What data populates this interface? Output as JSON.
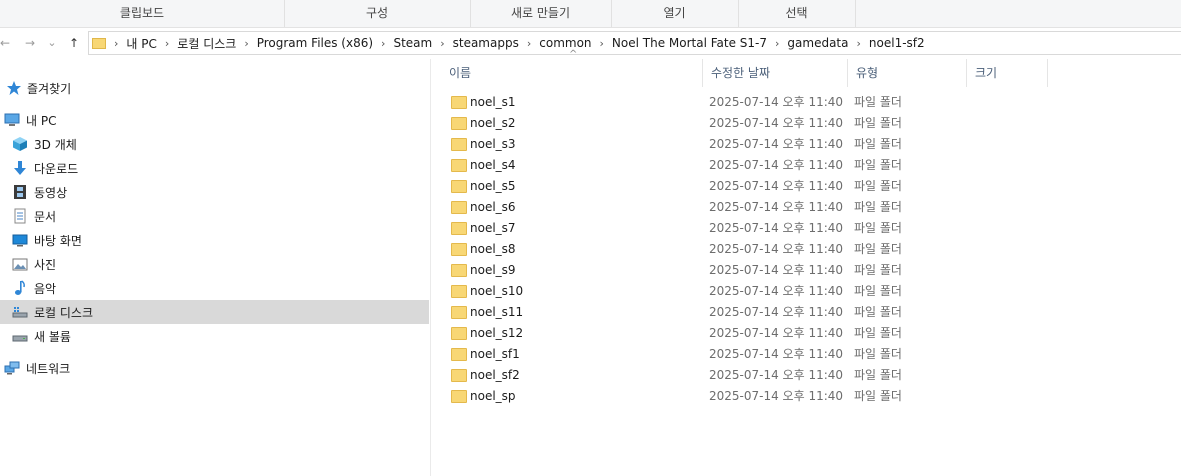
{
  "ribbon": {
    "groups": [
      "클립보드",
      "구성",
      "새로 만들기",
      "열기",
      "선택"
    ]
  },
  "nav_buttons": {
    "back": "←",
    "forward": "→",
    "recent": "⌄",
    "up": "↑"
  },
  "address": {
    "crumbs": [
      "내 PC",
      "로컬 디스크",
      "Program Files (x86)",
      "Steam",
      "steamapps",
      "common",
      "Noel The Mortal Fate S1-7",
      "gamedata",
      "noel1-sf2"
    ],
    "separator": "›"
  },
  "sidebar": {
    "items": [
      {
        "label": "즐겨찾기",
        "icon": "star-icon"
      },
      {
        "label": "내 PC",
        "icon": "pc-icon"
      },
      {
        "label": "3D 개체",
        "icon": "cube-icon"
      },
      {
        "label": "다운로드",
        "icon": "download-icon"
      },
      {
        "label": "동영상",
        "icon": "film-icon"
      },
      {
        "label": "문서",
        "icon": "document-icon"
      },
      {
        "label": "바탕 화면",
        "icon": "desktop-icon"
      },
      {
        "label": "사진",
        "icon": "picture-icon"
      },
      {
        "label": "음악",
        "icon": "music-icon"
      },
      {
        "label": "로컬 디스크",
        "icon": "drive-icon"
      },
      {
        "label": "새 볼륨",
        "icon": "drive-icon"
      },
      {
        "label": "네트워크",
        "icon": "network-icon"
      }
    ]
  },
  "columns": {
    "name": "이름",
    "date": "수정한 날짜",
    "type": "유형",
    "size": "크기",
    "sort_indicator": "^"
  },
  "files": [
    {
      "name": "noel_s1",
      "date": "2025-07-14 오후 11:40",
      "type": "파일 폴더"
    },
    {
      "name": "noel_s2",
      "date": "2025-07-14 오후 11:40",
      "type": "파일 폴더"
    },
    {
      "name": "noel_s3",
      "date": "2025-07-14 오후 11:40",
      "type": "파일 폴더"
    },
    {
      "name": "noel_s4",
      "date": "2025-07-14 오후 11:40",
      "type": "파일 폴더"
    },
    {
      "name": "noel_s5",
      "date": "2025-07-14 오후 11:40",
      "type": "파일 폴더"
    },
    {
      "name": "noel_s6",
      "date": "2025-07-14 오후 11:40",
      "type": "파일 폴더"
    },
    {
      "name": "noel_s7",
      "date": "2025-07-14 오후 11:40",
      "type": "파일 폴더"
    },
    {
      "name": "noel_s8",
      "date": "2025-07-14 오후 11:40",
      "type": "파일 폴더"
    },
    {
      "name": "noel_s9",
      "date": "2025-07-14 오후 11:40",
      "type": "파일 폴더"
    },
    {
      "name": "noel_s10",
      "date": "2025-07-14 오후 11:40",
      "type": "파일 폴더"
    },
    {
      "name": "noel_s11",
      "date": "2025-07-14 오후 11:40",
      "type": "파일 폴더"
    },
    {
      "name": "noel_s12",
      "date": "2025-07-14 오후 11:40",
      "type": "파일 폴더"
    },
    {
      "name": "noel_sf1",
      "date": "2025-07-14 오후 11:40",
      "type": "파일 폴더"
    },
    {
      "name": "noel_sf2",
      "date": "2025-07-14 오후 11:40",
      "type": "파일 폴더"
    },
    {
      "name": "noel_sp",
      "date": "2025-07-14 오후 11:40",
      "type": "파일 폴더"
    }
  ],
  "colors": {
    "folder": "#f8d775",
    "selection": "#d9d9d9",
    "header_text": "#4c607a"
  }
}
